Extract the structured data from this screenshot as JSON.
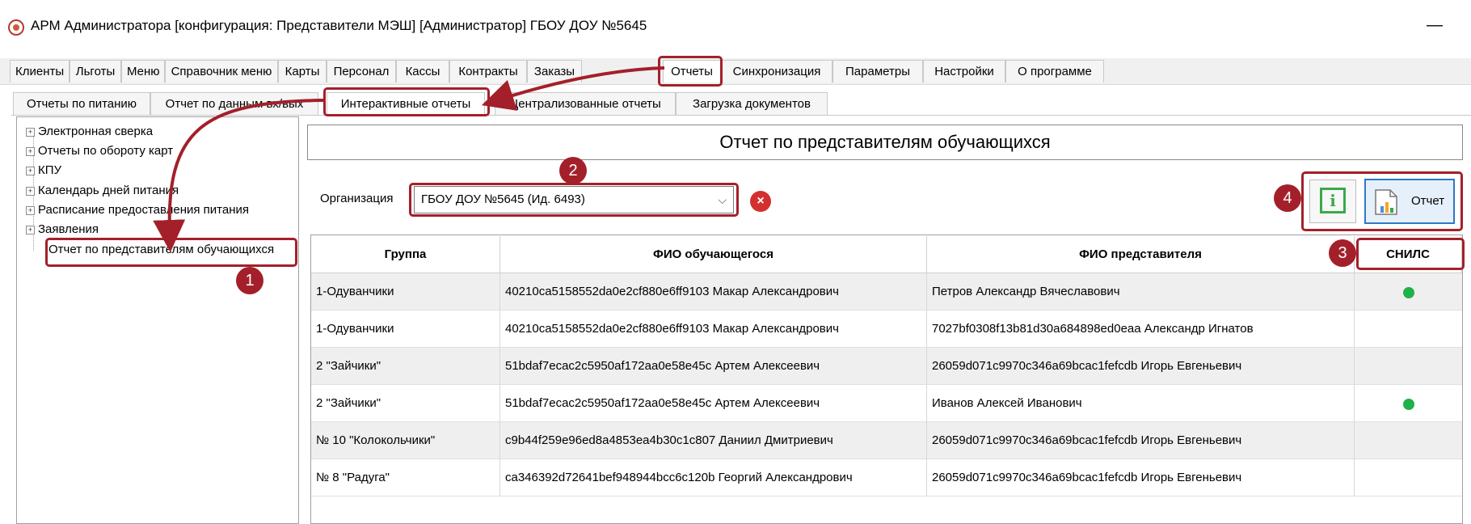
{
  "window": {
    "title": "АРМ Администратора [конфигурация: Представители МЭШ] [Администратор] ГБОУ ДОУ №5645",
    "minimize_glyph": "—"
  },
  "menu_tabs": [
    "Клиенты",
    "Льготы",
    "Меню",
    "Справочник меню",
    "Карты",
    "Персонал",
    "Кассы",
    "Контракты",
    "Заказы",
    "Отчеты",
    "Синхронизация",
    "Параметры",
    "Настройки",
    "О программе"
  ],
  "sub_tabs": [
    "Отчеты по питанию",
    "Отчет по данным вх/вых",
    "Интерактивные отчеты",
    "Централизованные отчеты",
    "Загрузка документов"
  ],
  "tree": {
    "items": [
      "Электронная сверка",
      "Отчеты по обороту карт",
      "КПУ",
      "Календарь дней питания",
      "Расписание предоставления питания",
      "Заявления"
    ],
    "leaf": "Отчет по представителям обучающихся"
  },
  "report": {
    "title": "Отчет по представителям обучающихся",
    "org_label": "Организация",
    "org_value": "ГБОУ ДОУ №5645 (Ид. 6493)",
    "report_button": "Отчет"
  },
  "grid": {
    "headers": [
      "Группа",
      "ФИО обучающегося",
      "ФИО представителя",
      "СНИЛС"
    ],
    "rows": [
      {
        "group": "1-Одуванчики",
        "student": "40210ca5158552da0e2cf880e6ff9103 Макар Александрович",
        "parent": "Петров Александр Вячеславович",
        "snils": true
      },
      {
        "group": "1-Одуванчики",
        "student": "40210ca5158552da0e2cf880e6ff9103 Макар Александрович",
        "parent": "7027bf0308f13b81d30a684898ed0eaa Александр Игнатов",
        "snils": false
      },
      {
        "group": "2 \"Зайчики\"",
        "student": "51bdaf7ecac2c5950af172aa0e58e45c Артем Алексеевич",
        "parent": "26059d071c9970c346a69bcac1fefcdb Игорь Евгеньевич",
        "snils": false
      },
      {
        "group": "2 \"Зайчики\"",
        "student": "51bdaf7ecac2c5950af172aa0e58e45c Артем Алексеевич",
        "parent": "Иванов Алексей Иванович",
        "snils": true
      },
      {
        "group": "№ 10 \"Колокольчики\"",
        "student": "c9b44f259e96ed8a4853ea4b30c1c807 Даниил Дмитриевич",
        "parent": "26059d071c9970c346a69bcac1fefcdb Игорь Евгеньевич",
        "snils": false
      },
      {
        "group": "№ 8 \"Радуга\"",
        "student": "ca346392d72641bef948944bcc6c120b Георгий Александрович",
        "parent": "26059d071c9970c346a69bcac1fefcdb Игорь Евгеньевич",
        "snils": false
      }
    ]
  },
  "annotations": [
    "1",
    "2",
    "3",
    "4"
  ],
  "colors": {
    "annotation": "#a3202a",
    "snils_dot": "#21b14a",
    "info_icon": "#3aa94a",
    "report_button_border": "#2f78c4",
    "clear_button": "#d32f2f"
  },
  "icons": {
    "clear": "×",
    "info": "i",
    "chevron": "⌵",
    "tree_plus": "+"
  }
}
